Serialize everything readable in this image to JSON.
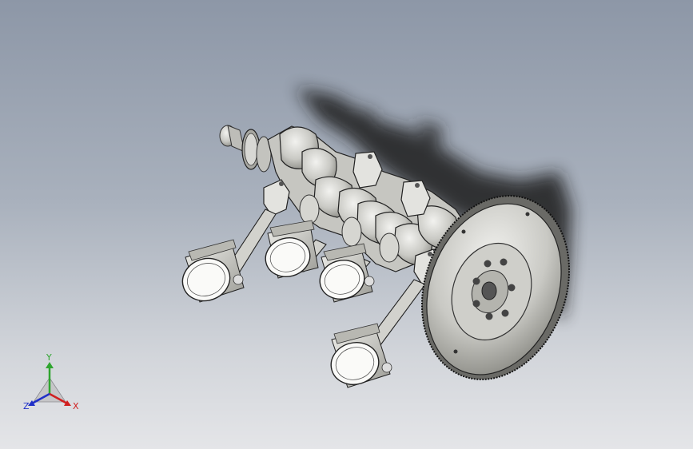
{
  "viewport": {
    "background_top": "#8d97a7",
    "background_bottom": "#e4e5e8",
    "model": "crankshaft-piston-flywheel-assembly",
    "render_style": "shaded-with-edges"
  },
  "triad": {
    "x_label": "X",
    "y_label": "Y",
    "z_label": "Z",
    "x_color": "#d02020",
    "y_color": "#2fa52f",
    "z_color": "#2030c8"
  }
}
